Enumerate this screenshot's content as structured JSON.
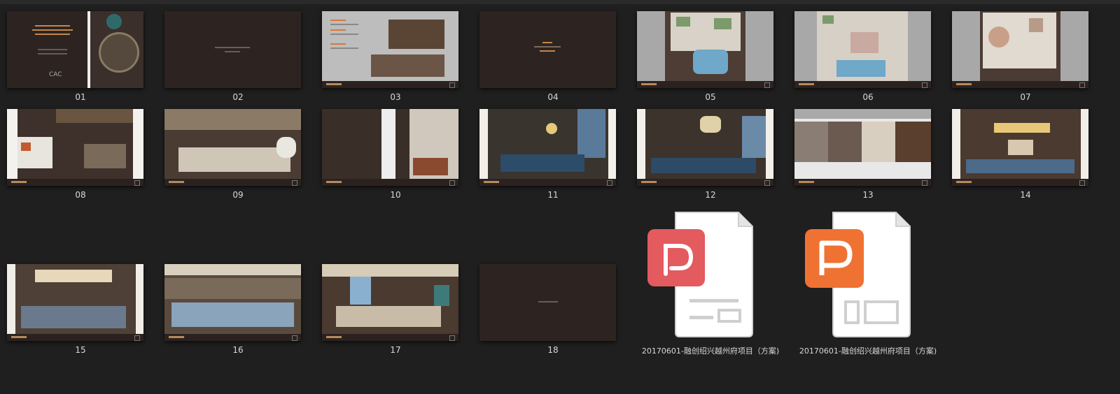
{
  "items": [
    {
      "label": "01"
    },
    {
      "label": "02"
    },
    {
      "label": "03"
    },
    {
      "label": "04"
    },
    {
      "label": "05"
    },
    {
      "label": "06"
    },
    {
      "label": "07"
    },
    {
      "label": "08"
    },
    {
      "label": "09"
    },
    {
      "label": "10"
    },
    {
      "label": "11"
    },
    {
      "label": "12"
    },
    {
      "label": "13"
    },
    {
      "label": "14"
    },
    {
      "label": "15"
    },
    {
      "label": "16"
    },
    {
      "label": "17"
    },
    {
      "label": "18"
    }
  ],
  "files": [
    {
      "label": "20170601-融创绍兴越州府项目（方案)",
      "icon": "pdf-icon",
      "color": "#e35a5f"
    },
    {
      "label": "20170601-融创绍兴越州府项目（方案)",
      "icon": "ppt-icon",
      "color": "#ef7233"
    }
  ],
  "cover_logo": "CAC"
}
